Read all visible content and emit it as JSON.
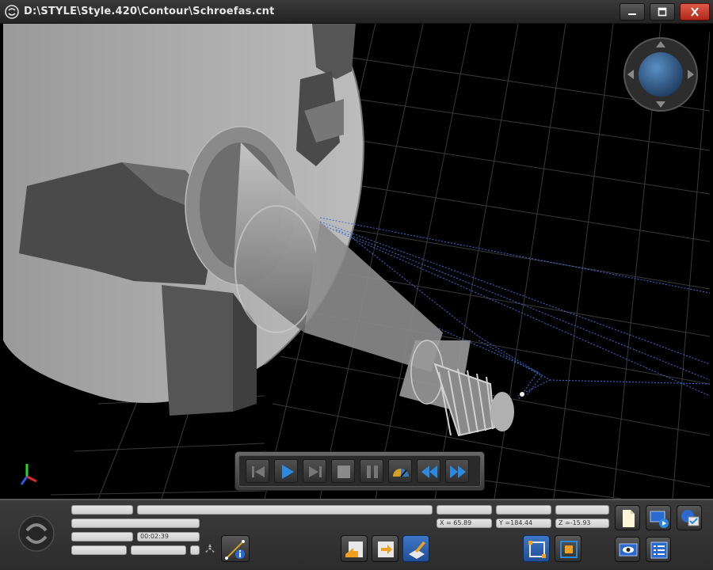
{
  "window": {
    "title": "D:\\STYLE\\Style.420\\Contour\\Schroefas.cnt"
  },
  "status": {
    "timer": "00:02:39",
    "coords": {
      "x": "X = 65.89",
      "y": "Y =184.44",
      "z": "Z =-15.93"
    }
  },
  "icons": {
    "app_logo": "swirl-logo-icon",
    "first": "skip-first-icon",
    "play": "play-icon",
    "last": "skip-last-icon",
    "stop": "stop-icon",
    "pause": "pause-icon",
    "speed": "speed-gauge-icon",
    "rewind": "rewind-icon",
    "forward": "fast-forward-icon"
  },
  "colors": {
    "accent": "#2a8ae0",
    "toolpath": "#3a6fd8"
  }
}
